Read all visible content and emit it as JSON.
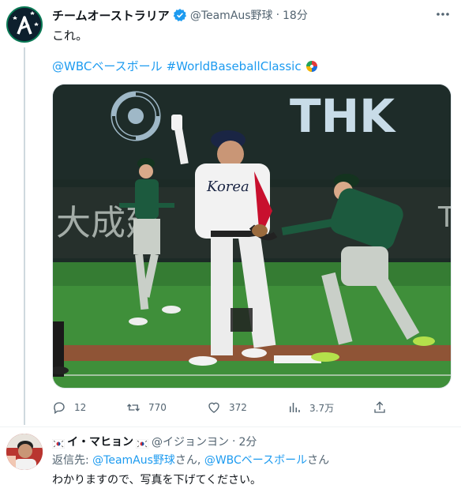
{
  "tweet": {
    "display_name": "チームオーストラリア",
    "handle": "@TeamAus野球",
    "separator": "·",
    "time": "18分",
    "text": "これ。",
    "hashtag_1": "@WBCベースボール",
    "hashtag_2": "#WorldBaseballClassic",
    "photo": {
      "banner_text": "THK",
      "ad_text": "大成建",
      "ad_text_right": "T",
      "jersey_text": "Korea",
      "description_colors": {
        "grass": "#3f8f3a",
        "wall": "#1c2a26",
        "dirt": "#9a5a3a",
        "korea_jersey": "#f2f2f2",
        "aus_jersey": "#1c5a3e"
      }
    },
    "actions": {
      "replies": "12",
      "retweets": "770",
      "likes": "372",
      "views": "3.7万"
    },
    "colors": {
      "accent": "#1d9bf0",
      "muted": "#536471",
      "verified": "#1d9bf0"
    }
  },
  "reply": {
    "display_name": "イ・マヒョン",
    "handle": "@イジョンヨン",
    "separator": "·",
    "time": "2分",
    "reply_prefix": "返信先: ",
    "mention_1": "@TeamAus野球",
    "san_1": "さん, ",
    "mention_2": "@WBCベースボール",
    "san_2": "さん",
    "text": "わかりますので、写真を下げてください。"
  }
}
